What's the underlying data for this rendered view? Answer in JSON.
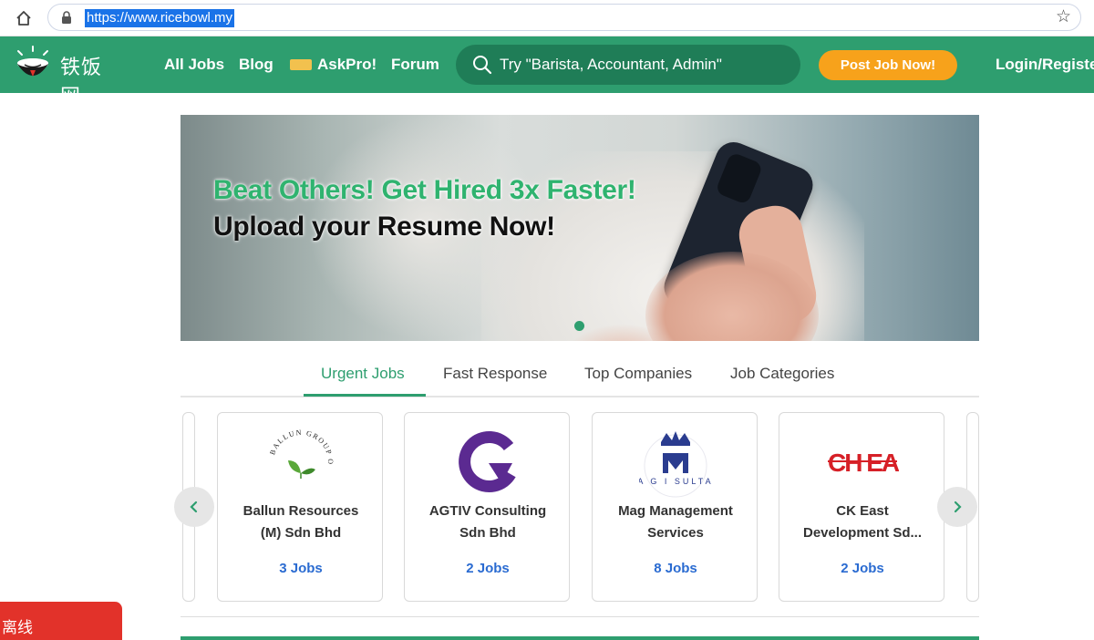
{
  "browser": {
    "url": "https://www.ricebowl.my"
  },
  "nav": {
    "logo_text": "铁饭网",
    "links": [
      {
        "label": "All Jobs"
      },
      {
        "label": "Blog"
      },
      {
        "label": "AskPro!"
      },
      {
        "label": "Forum"
      }
    ],
    "search_placeholder": "Try \"Barista, Accountant, Admin\"",
    "post_job_label": "Post Job Now!",
    "login_label": "Login/Register"
  },
  "banner": {
    "headline": "Beat Others! Get Hired 3x Faster!",
    "subheadline": "Upload your Resume Now!"
  },
  "tabs": [
    {
      "label": "Urgent Jobs",
      "active": true
    },
    {
      "label": "Fast Response",
      "active": false
    },
    {
      "label": "Top Companies",
      "active": false
    },
    {
      "label": "Job Categories",
      "active": false
    }
  ],
  "companies": [
    {
      "name_line1": "Ballun Resources",
      "name_line2": "(M) Sdn Bhd",
      "jobs": "3 Jobs",
      "logo_text": "BALLUN GROUP OF COMPANIES"
    },
    {
      "name_line1": "AGTIV Consulting",
      "name_line2": "Sdn Bhd",
      "jobs": "2 Jobs"
    },
    {
      "name_line1": "Mag Management",
      "name_line2": "Services",
      "jobs": "8 Jobs",
      "logo_text": "A G I SULTA"
    },
    {
      "name_line1": "CK East",
      "name_line2": "Development Sd...",
      "jobs": "2 Jobs",
      "logo_text": "CH EAST 東昇"
    }
  ],
  "offline_badge": "离线",
  "colors": {
    "brand_green": "#2e9e6f",
    "accent_orange": "#f7a21b",
    "link_blue": "#2a6bd1",
    "offline_red": "#e2322a"
  }
}
